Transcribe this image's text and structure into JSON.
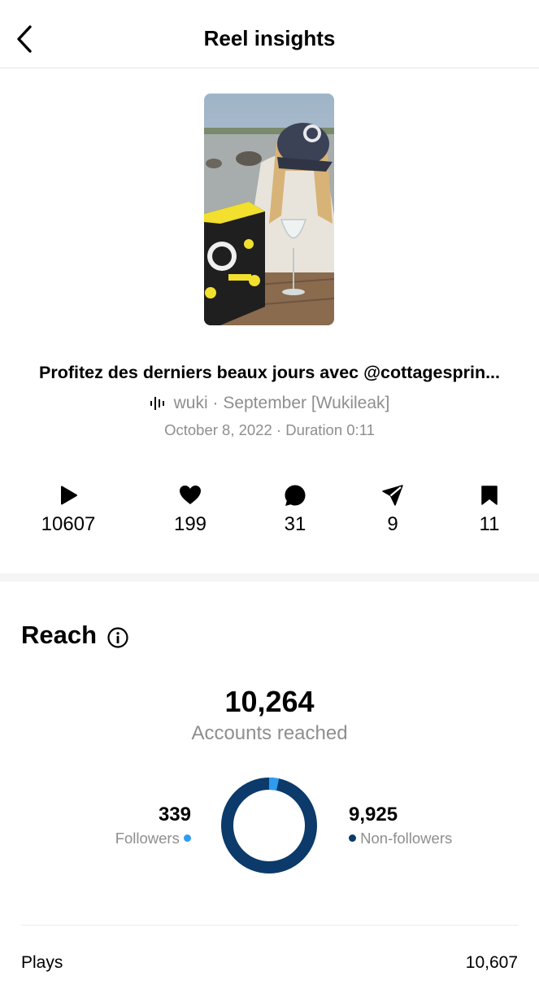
{
  "header": {
    "title": "Reel insights"
  },
  "reel": {
    "caption": "Profitez des derniers beaux jours avec @cottagesprin...",
    "audio": "wuki · September [Wukileak]",
    "date_duration": "October 8, 2022 · Duration 0:11"
  },
  "stats": [
    {
      "icon": "play-icon",
      "value": "10607"
    },
    {
      "icon": "heart-icon",
      "value": "199"
    },
    {
      "icon": "comment-icon",
      "value": "31"
    },
    {
      "icon": "share-icon",
      "value": "9"
    },
    {
      "icon": "bookmark-icon",
      "value": "11"
    }
  ],
  "reach": {
    "title": "Reach",
    "accounts_reached": "10,264",
    "accounts_reached_label": "Accounts reached",
    "followers": {
      "value": "339",
      "label": "Followers",
      "color": "#2d9cf0"
    },
    "non_followers": {
      "value": "9,925",
      "label": "Non-followers",
      "color": "#0b3a6b"
    },
    "followers_fraction": 0.033
  },
  "plays": {
    "label": "Plays",
    "value": "10,607"
  }
}
